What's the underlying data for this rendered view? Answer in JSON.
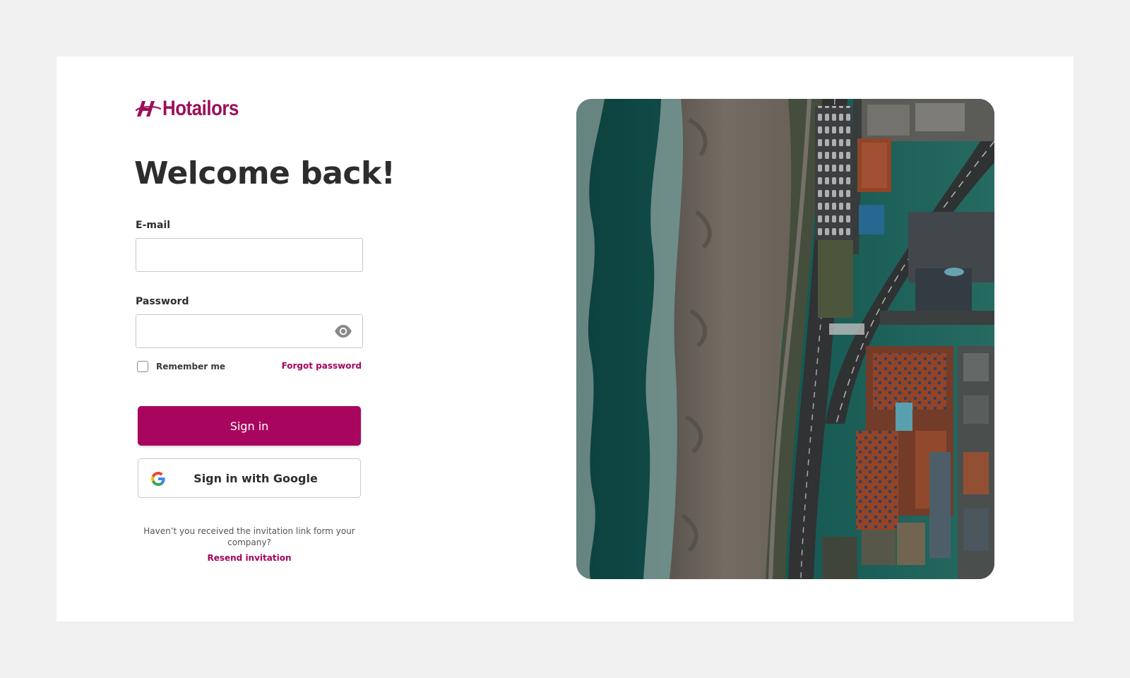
{
  "brand": {
    "name": "Hotailors",
    "color": "#9b0f5a",
    "logo_icon": "hotailors-h-logo-icon"
  },
  "login": {
    "title": "Welcome back!",
    "email_label": "E-mail",
    "email_value": "",
    "email_placeholder": "",
    "password_label": "Password",
    "password_value": "",
    "password_placeholder": "",
    "password_toggle_icon": "eye-icon",
    "remember_label": "Remember me",
    "remember_checked": false,
    "forgot_label": "Forgot password",
    "signin_label": "Sign in",
    "google_label": "Sign in with Google",
    "google_icon": "google-g-icon",
    "help_text": "Haven’t you received the invitation link form your company?",
    "resend_label": "Resend invitation"
  },
  "hero": {
    "image": "aerial-coastline-photo",
    "alt": "Aerial view of ocean, beach and coastal road with buildings"
  },
  "colors": {
    "accent": "#a8065e",
    "page_background": "#f0f0f0",
    "card_background": "#ffffff",
    "text": "#2d2d2d"
  }
}
